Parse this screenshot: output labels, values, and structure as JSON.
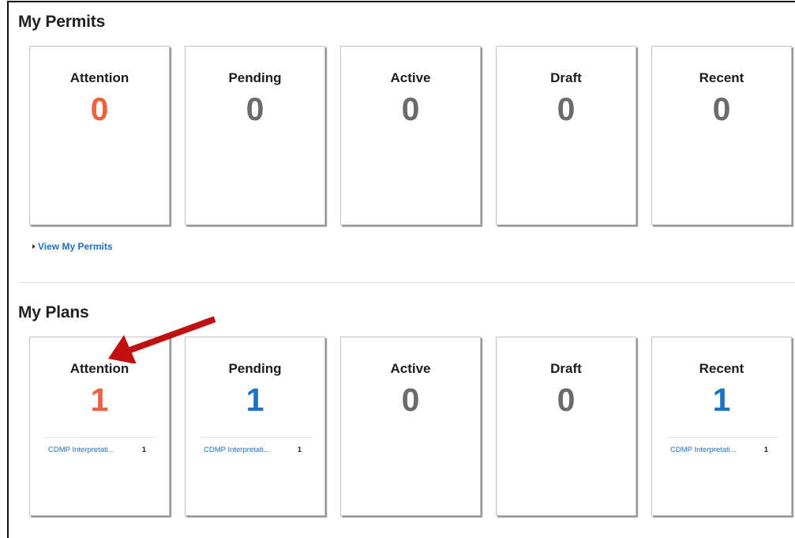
{
  "permits": {
    "title": "My Permits",
    "cards": [
      {
        "label": "Attention",
        "count": "0",
        "status": "attention"
      },
      {
        "label": "Pending",
        "count": "0",
        "status": "neutral"
      },
      {
        "label": "Active",
        "count": "0",
        "status": "neutral"
      },
      {
        "label": "Draft",
        "count": "0",
        "status": "neutral"
      },
      {
        "label": "Recent",
        "count": "0",
        "status": "neutral"
      }
    ],
    "view_link": "View My Permits"
  },
  "plans": {
    "title": "My Plans",
    "cards": [
      {
        "label": "Attention",
        "count": "1",
        "status": "attention",
        "items": [
          {
            "name": "CDMP Interpretati...",
            "count": "1"
          }
        ]
      },
      {
        "label": "Pending",
        "count": "1",
        "status": "blue",
        "items": [
          {
            "name": "CDMP Interpretati...",
            "count": "1"
          }
        ]
      },
      {
        "label": "Active",
        "count": "0",
        "status": "neutral",
        "items": []
      },
      {
        "label": "Draft",
        "count": "0",
        "status": "neutral",
        "items": []
      },
      {
        "label": "Recent",
        "count": "1",
        "status": "blue",
        "items": [
          {
            "name": "CDMP Interpretati...",
            "count": "1"
          }
        ]
      }
    ]
  },
  "colors": {
    "attention": "#ee6142",
    "blue": "#1d73c2",
    "neutral": "#6b6b6b",
    "link": "#1d6fc1",
    "arrow": "#c0100f"
  },
  "annotation": {
    "icon": "red-arrow-icon"
  }
}
